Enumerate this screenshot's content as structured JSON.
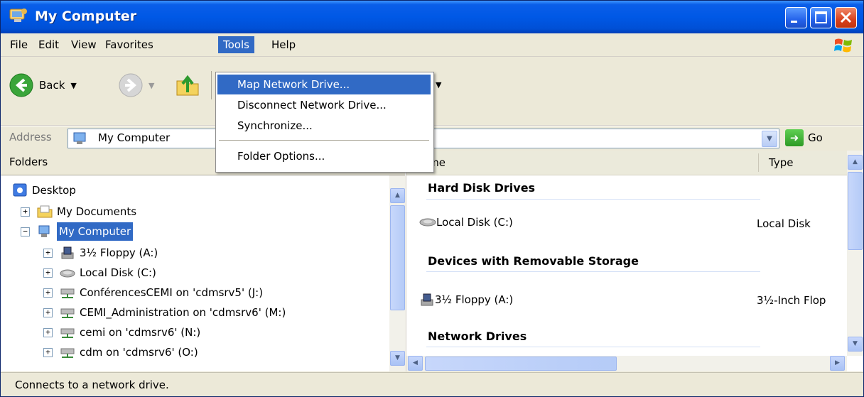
{
  "window": {
    "title": "My Computer",
    "title_icon": "my-computer-icon",
    "controls": [
      "minimize",
      "maximize",
      "close"
    ]
  },
  "menubar": {
    "items": [
      {
        "label": "File"
      },
      {
        "label": "Edit"
      },
      {
        "label": "View"
      },
      {
        "label": "Favorites"
      },
      {
        "label": "Tools",
        "active": true
      },
      {
        "label": "Help"
      }
    ]
  },
  "tools_menu": {
    "items": [
      {
        "label": "Map Network Drive...",
        "highlighted": true
      },
      {
        "label": "Disconnect Network Drive..."
      },
      {
        "label": "Synchronize..."
      },
      {
        "label": "Folder Options..."
      }
    ]
  },
  "toolbar": {
    "back_label": "Back"
  },
  "address": {
    "label": "Address",
    "value": "My Computer",
    "go_label": "Go"
  },
  "folders": {
    "title": "Folders",
    "tree": [
      {
        "label": "Desktop",
        "icon": "desktop-icon"
      },
      {
        "label": "My Documents",
        "icon": "folder-icon"
      },
      {
        "label": "My Computer",
        "icon": "computer-icon",
        "selected": true
      },
      {
        "label": "3½ Floppy (A:)",
        "icon": "floppy-icon"
      },
      {
        "label": "Local Disk (C:)",
        "icon": "disk-icon"
      },
      {
        "label": "ConférencesCEMI on 'cdmsrv5' (J:)",
        "icon": "network-drive-icon"
      },
      {
        "label": "CEMI_Administration on 'cdmsrv6' (M:)",
        "icon": "network-drive-icon"
      },
      {
        "label": "cemi on 'cdmsrv6' (N:)",
        "icon": "network-drive-icon"
      },
      {
        "label": "cdm on 'cdmsrv6' (O:)",
        "icon": "network-drive-icon"
      }
    ]
  },
  "content": {
    "columns": {
      "name": "ame",
      "type": "Type"
    },
    "groups": [
      {
        "heading": "Hard Disk Drives",
        "items": [
          {
            "name": "Local Disk (C:)",
            "type": "Local Disk"
          }
        ]
      },
      {
        "heading": "Devices with Removable Storage",
        "items": [
          {
            "name": "3½ Floppy (A:)",
            "type": "3½-Inch Flop"
          }
        ]
      },
      {
        "heading": "Network Drives",
        "items": []
      }
    ]
  },
  "status": {
    "text": "Connects to a network drive."
  }
}
